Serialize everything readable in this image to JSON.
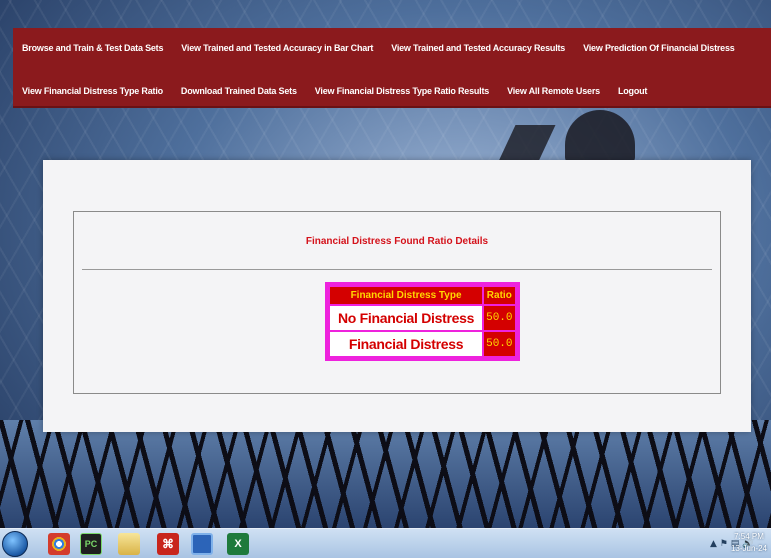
{
  "nav": {
    "row1": [
      "Browse and Train & Test Data Sets",
      "View Trained and Tested Accuracy in Bar Chart",
      "View Trained and Tested Accuracy Results",
      "View Prediction Of Financial Distress"
    ],
    "row2": [
      "View Financial Distress Type Ratio",
      "Download Trained Data Sets",
      "View Financial Distress Type Ratio Results",
      "View All Remote Users",
      "Logout"
    ]
  },
  "content": {
    "title": "Financial Distress Found Ratio Details",
    "table": {
      "headers": [
        "Financial Distress Type",
        "Ratio"
      ],
      "rows": [
        [
          "No Financial Distress",
          "50.0"
        ],
        [
          "Financial Distress",
          "50.0"
        ]
      ]
    }
  },
  "taskbar": {
    "icons": [
      "chrome-icon",
      "pycharm-icon",
      "file-explorer-icon",
      "acrobat-icon",
      "python-icon",
      "excel-icon"
    ],
    "clock_time": "7:54 PM",
    "clock_date": "13-Jun-24"
  },
  "colors": {
    "nav_bg": "#8b1a1d",
    "title": "#d4121b",
    "table_border": "#ee22dd",
    "table_header_bg": "#d40000",
    "table_header_text": "#ffd800"
  }
}
